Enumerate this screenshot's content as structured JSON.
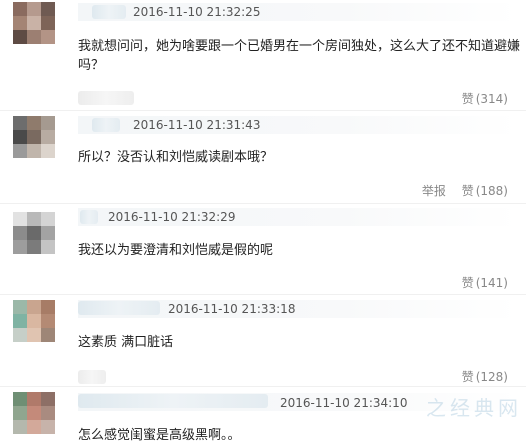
{
  "comments": [
    {
      "timestamp": "2016-11-10 21:32:25",
      "text_line1": "我就想问问，她为啥要跟一个已婚男在一个房间独处，这么大了还不知道避嫌",
      "text_line2": "吗？",
      "report_label": "",
      "like_label": "赞",
      "like_count": "(314)",
      "avatar_colors": [
        "#8a6b5f",
        "#b59a8e",
        "#6f5a52",
        "#a48474",
        "#c9b2a6",
        "#7e6458",
        "#5e4b44",
        "#9c7f72",
        "#b39486"
      ]
    },
    {
      "timestamp": "2016-11-10 21:31:43",
      "text_line1": "所以？没否认和刘恺威读剧本哦？",
      "text_line2": "",
      "report_label": "举报",
      "like_label": "赞",
      "like_count": "(188)",
      "avatar_colors": [
        "#6d6d6d",
        "#8f7b6c",
        "#a59a90",
        "#4a4a4a",
        "#7a6a60",
        "#b8aca2",
        "#9a9a9a",
        "#c0b5ab",
        "#dcd4cc"
      ]
    },
    {
      "timestamp": "2016-11-10 21:32:29",
      "text_line1": "我还以为要澄清和刘恺威是假的呢",
      "text_line2": "",
      "report_label": "",
      "like_label": "赞",
      "like_count": "(141)",
      "avatar_colors": [
        "#e2e2e2",
        "#b9b9b9",
        "#d4d4d4",
        "#8c8c8c",
        "#6a6a6a",
        "#a3a3a3",
        "#9d9d9d",
        "#7b7b7b",
        "#c4c4c4"
      ]
    },
    {
      "timestamp": "2016-11-10 21:33:18",
      "text_line1": "这素质 满口脏话",
      "text_line2": "",
      "report_label": "",
      "like_label": "赞",
      "like_count": "(128)",
      "avatar_colors": [
        "#9bb8a8",
        "#c9a58f",
        "#a77c66",
        "#7fb3a3",
        "#d9b7a1",
        "#b48a74",
        "#c6cfc8",
        "#e0c4b1",
        "#9e8677"
      ]
    },
    {
      "timestamp": "2016-11-10 21:34:10",
      "text_line1": "怎么感觉闺蜜是高级黑啊。。",
      "text_line2": "",
      "report_label": "",
      "like_label": "",
      "like_count": "",
      "avatar_colors": [
        "#6f8f74",
        "#b07a6a",
        "#8d6f66",
        "#90a68f",
        "#c48a7a",
        "#a98b80",
        "#b4b8ad",
        "#d3a99a",
        "#c7b3aa"
      ]
    }
  ],
  "watermark": "之经典网"
}
